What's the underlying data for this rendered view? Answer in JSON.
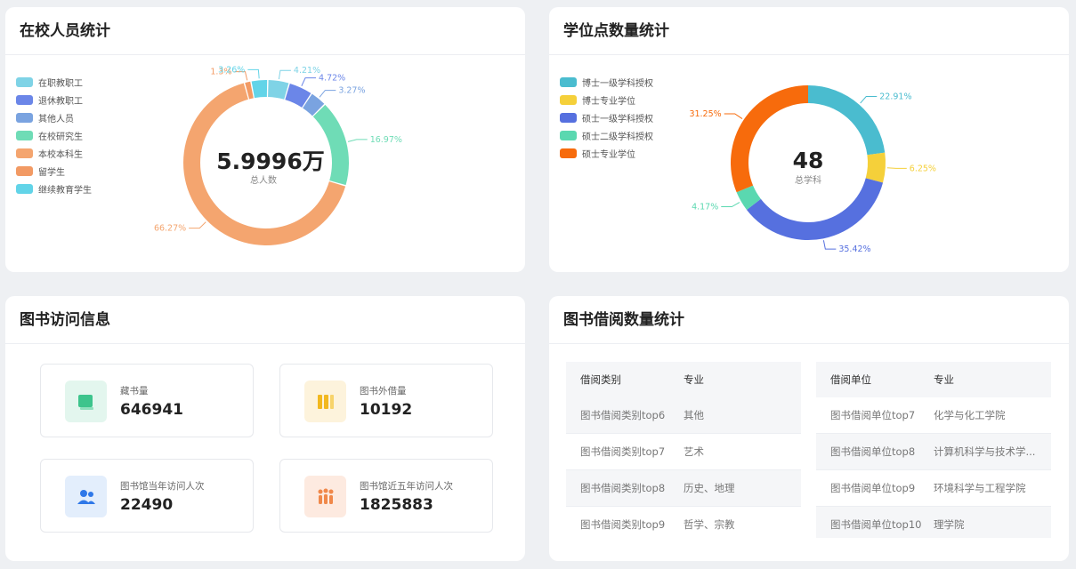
{
  "personnel": {
    "title": "在校人员统计",
    "center_value": "5.9996万",
    "center_label": "总人数",
    "legend": [
      {
        "label": "在职教职工",
        "color": "#7fd3e6"
      },
      {
        "label": "退休教职工",
        "color": "#6b86e8"
      },
      {
        "label": "其他人员",
        "color": "#7aa3e0"
      },
      {
        "label": "在校研究生",
        "color": "#6fdcb6"
      },
      {
        "label": "本校本科生",
        "color": "#f4a56f"
      },
      {
        "label": "留学生",
        "color": "#f29a64"
      },
      {
        "label": "继续教育学生",
        "color": "#62d4e8"
      }
    ]
  },
  "degree": {
    "title": "学位点数量统计",
    "center_value": "48",
    "center_label": "总学科",
    "legend": [
      {
        "label": "博士一级学科授权",
        "color": "#4abccf"
      },
      {
        "label": "博士专业学位",
        "color": "#f5d03a"
      },
      {
        "label": "硕士一级学科授权",
        "color": "#5670df"
      },
      {
        "label": "硕士二级学科授权",
        "color": "#5ad8b0"
      },
      {
        "label": "硕士专业学位",
        "color": "#f76b0c"
      }
    ]
  },
  "chart_data": [
    {
      "type": "pie",
      "title": "在校人员统计",
      "categories": [
        "在职教职工",
        "退休教职工",
        "其他人员",
        "在校研究生",
        "本校本科生",
        "留学生",
        "继续教育学生"
      ],
      "values": [
        4.21,
        4.72,
        3.27,
        16.97,
        66.27,
        1.3,
        3.26
      ],
      "labels": [
        "4.21%",
        "4.72%",
        "3.27%",
        "16.97%",
        "66.27%",
        "1.3%",
        "3.26%"
      ],
      "colors": [
        "#7fd3e6",
        "#6b86e8",
        "#7aa3e0",
        "#6fdcb6",
        "#f4a56f",
        "#f29a64",
        "#62d4e8"
      ]
    },
    {
      "type": "pie",
      "title": "学位点数量统计",
      "categories": [
        "博士一级学科授权",
        "博士专业学位",
        "硕士一级学科授权",
        "硕士二级学科授权",
        "硕士专业学位"
      ],
      "values": [
        22.91,
        6.25,
        35.42,
        4.17,
        31.25
      ],
      "labels": [
        "22.91%",
        "6.25%",
        "35.42%",
        "4.17%",
        "31.25%"
      ],
      "colors": [
        "#4abccf",
        "#f5d03a",
        "#5670df",
        "#5ad8b0",
        "#f76b0c"
      ]
    }
  ],
  "library": {
    "title": "图书访问信息",
    "cards": [
      {
        "label": "藏书量",
        "value": "646941",
        "icon": "book-icon",
        "bg": "#e3f6ee",
        "color": "#3dc48c"
      },
      {
        "label": "图书外借量",
        "value": "10192",
        "icon": "books-icon",
        "bg": "#fdf3dc",
        "color": "#f2b81f"
      },
      {
        "label": "图书馆当年访问人次",
        "value": "22490",
        "icon": "users-icon",
        "bg": "#e3eefc",
        "color": "#2f78e8"
      },
      {
        "label": "图书馆近五年访问人次",
        "value": "1825883",
        "icon": "group-icon",
        "bg": "#fdeae0",
        "color": "#f0884a"
      }
    ]
  },
  "borrow": {
    "title": "图书借阅数量统计",
    "left": {
      "headers": [
        "借阅类别",
        "专业"
      ],
      "rows": [
        [
          "图书借阅类别top6",
          "其他"
        ],
        [
          "图书借阅类别top7",
          "艺术"
        ],
        [
          "图书借阅类别top8",
          "历史、地理"
        ],
        [
          "图书借阅类别top9",
          "哲学、宗教"
        ]
      ]
    },
    "right": {
      "headers": [
        "借阅单位",
        "专业"
      ],
      "rows": [
        [
          "图书借阅单位top7",
          "化学与化工学院"
        ],
        [
          "图书借阅单位top8",
          "计算机科学与技术学..."
        ],
        [
          "图书借阅单位top9",
          "环境科学与工程学院"
        ],
        [
          "图书借阅单位top10",
          "理学院"
        ]
      ]
    }
  }
}
